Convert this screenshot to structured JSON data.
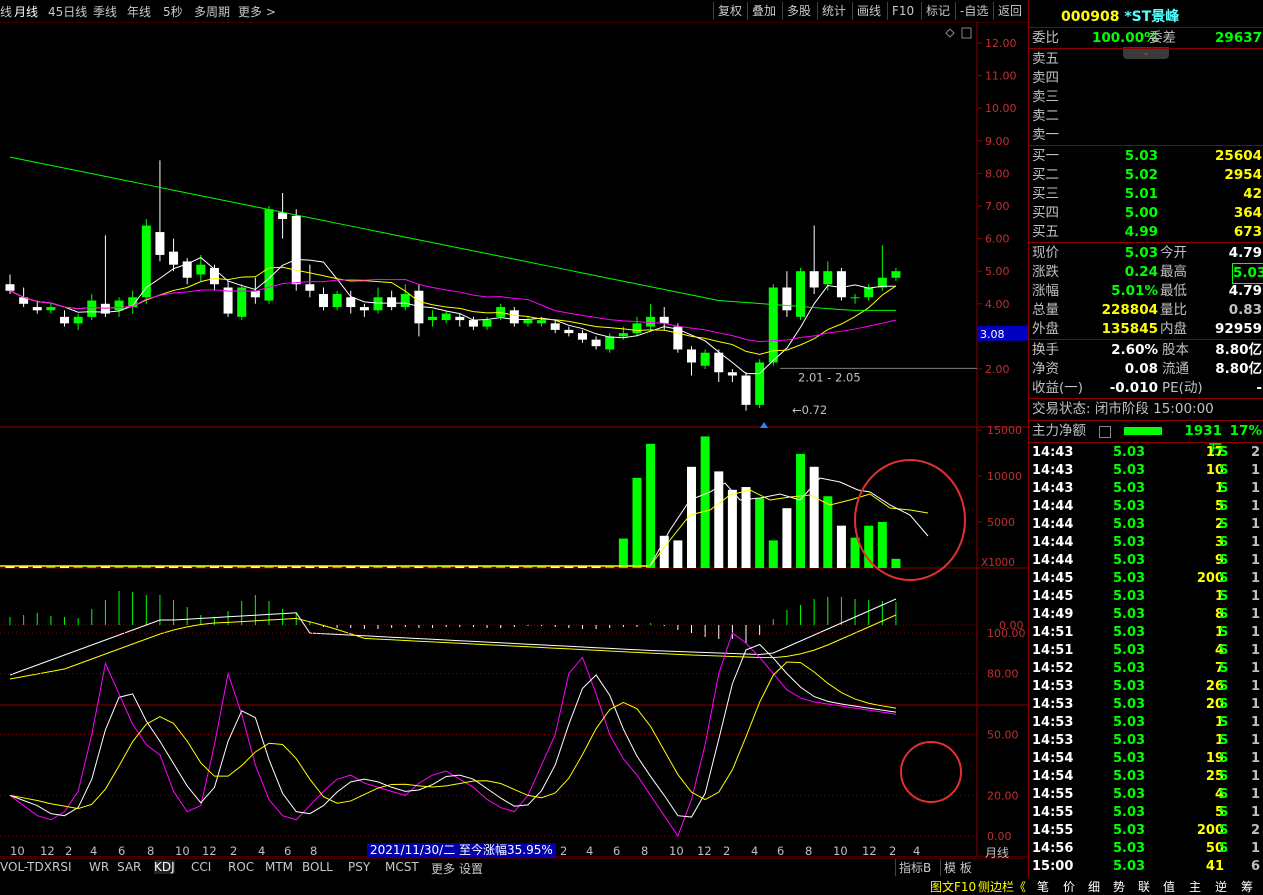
{
  "toolbar": {
    "periods": [
      "线",
      "月线",
      "45日线",
      "季线",
      "年线",
      "5秒",
      "多周期",
      "更多 >"
    ],
    "buttons": [
      "复权",
      "叠加",
      "多股",
      "统计",
      "画线",
      "F10",
      "标记",
      "-自选",
      "返回"
    ]
  },
  "price_axis": [
    "12.00",
    "11.00",
    "10.00",
    "9.00",
    "8.00",
    "7.00",
    "6.00",
    "5.00",
    "4.00",
    "3.00",
    "2.00"
  ],
  "current_price_tag": "3.08",
  "vol_axis": [
    "15000",
    "10000",
    "5000",
    "X1000"
  ],
  "macd_axis": [
    "0.00"
  ],
  "kdj_axis": [
    "100.00",
    "80.00",
    "50.00",
    "20.00",
    "0.00"
  ],
  "annotations": {
    "range_label": "2.01 - 2.05",
    "low_label": "←0.72"
  },
  "x_axis_labels": [
    "10",
    "12",
    "2",
    "4",
    "6",
    "8",
    "10",
    "12",
    "2",
    "4",
    "6",
    "8",
    "10"
  ],
  "x_axis_labels_right": [
    "12",
    "2",
    "4",
    "6",
    "8",
    "10",
    "12",
    "2",
    "4",
    "6",
    "8",
    "10",
    "12",
    "2",
    "4"
  ],
  "period_label": "月线",
  "tooltip": "2021/11/30/二  至今涨幅35.95%",
  "indicator_tabs": [
    "VOL-TDX",
    "RSI",
    "WR",
    "SAR",
    "KDJ",
    "CCI",
    "ROC",
    "MTM",
    "BOLL",
    "PSY",
    "MCST",
    "更多",
    "设置"
  ],
  "stock": {
    "code": "000908",
    "name": "*ST景峰"
  },
  "order_ratio": {
    "label": "委比",
    "value": "100.00%",
    "diff_label": "委差",
    "diff_value": "29637"
  },
  "sell_levels": [
    "卖五",
    "卖四",
    "卖三",
    "卖二",
    "卖一"
  ],
  "buy_levels": [
    {
      "label": "买一",
      "price": "5.03",
      "vol": "25604"
    },
    {
      "label": "买二",
      "price": "5.02",
      "vol": "2954"
    },
    {
      "label": "买三",
      "price": "5.01",
      "vol": "42"
    },
    {
      "label": "买四",
      "price": "5.00",
      "vol": "364"
    },
    {
      "label": "买五",
      "price": "4.99",
      "vol": "673"
    }
  ],
  "quote": [
    {
      "l1": "现价",
      "v1": "5.03",
      "l2": "今开",
      "v2": "4.79"
    },
    {
      "l1": "涨跌",
      "v1": "0.24",
      "l2": "最高",
      "v2": "5.03"
    },
    {
      "l1": "涨幅",
      "v1": "5.01%",
      "l2": "最低",
      "v2": "4.79"
    },
    {
      "l1": "总量",
      "v1": "228804",
      "l2": "量比",
      "v2": "0.83"
    },
    {
      "l1": "外盘",
      "v1": "135845",
      "l2": "内盘",
      "v2": "92959"
    }
  ],
  "stats": [
    {
      "l1": "换手",
      "v1": "2.60%",
      "l2": "股本",
      "v2": "8.80亿"
    },
    {
      "l1": "净资",
      "v1": "0.08",
      "l2": "流通",
      "v2": "8.80亿"
    },
    {
      "l1": "收益(一)",
      "v1": "-0.010",
      "l2": "PE(动)",
      "v2": "-"
    }
  ],
  "trade_status": "交易状态: 闭市阶段 15:00:00",
  "main_flow": {
    "label": "主力净额",
    "value": "1931万",
    "pct": "17%"
  },
  "ticks": [
    [
      "14:43",
      "5.03",
      "17",
      "S",
      "2"
    ],
    [
      "14:43",
      "5.03",
      "10",
      "S",
      "1"
    ],
    [
      "14:43",
      "5.03",
      "1",
      "S",
      "1"
    ],
    [
      "14:44",
      "5.03",
      "5",
      "S",
      "1"
    ],
    [
      "14:44",
      "5.03",
      "2",
      "S",
      "1"
    ],
    [
      "14:44",
      "5.03",
      "3",
      "S",
      "1"
    ],
    [
      "14:44",
      "5.03",
      "9",
      "S",
      "1"
    ],
    [
      "14:45",
      "5.03",
      "200",
      "S",
      "1"
    ],
    [
      "14:45",
      "5.03",
      "1",
      "S",
      "1"
    ],
    [
      "14:49",
      "5.03",
      "8",
      "S",
      "1"
    ],
    [
      "14:51",
      "5.03",
      "1",
      "S",
      "1"
    ],
    [
      "14:51",
      "5.03",
      "4",
      "S",
      "1"
    ],
    [
      "14:52",
      "5.03",
      "7",
      "S",
      "1"
    ],
    [
      "14:53",
      "5.03",
      "26",
      "S",
      "1"
    ],
    [
      "14:53",
      "5.03",
      "20",
      "S",
      "1"
    ],
    [
      "14:53",
      "5.03",
      "1",
      "S",
      "1"
    ],
    [
      "14:53",
      "5.03",
      "1",
      "S",
      "1"
    ],
    [
      "14:54",
      "5.03",
      "19",
      "S",
      "1"
    ],
    [
      "14:54",
      "5.03",
      "25",
      "S",
      "1"
    ],
    [
      "14:55",
      "5.03",
      "4",
      "S",
      "1"
    ],
    [
      "14:55",
      "5.03",
      "5",
      "S",
      "1"
    ],
    [
      "14:55",
      "5.03",
      "200",
      "S",
      "2"
    ],
    [
      "14:56",
      "5.03",
      "50",
      "S",
      "1"
    ],
    [
      "15:00",
      "5.03",
      "41",
      "",
      "6"
    ]
  ],
  "side_tabs": [
    "指标B",
    "模 板"
  ],
  "status_bar": [
    "图文F10",
    "侧边栏《",
    "笔",
    "价",
    "细",
    "势",
    "联",
    "值",
    "主",
    "逆",
    "筹"
  ],
  "colors": {
    "up": "#ff3232",
    "down": "#54ffff",
    "green": "#00ff00",
    "white": "#ffffff",
    "yellow": "#ffff00",
    "magenta": "#ff00ff",
    "grid": "#8b0000"
  }
}
